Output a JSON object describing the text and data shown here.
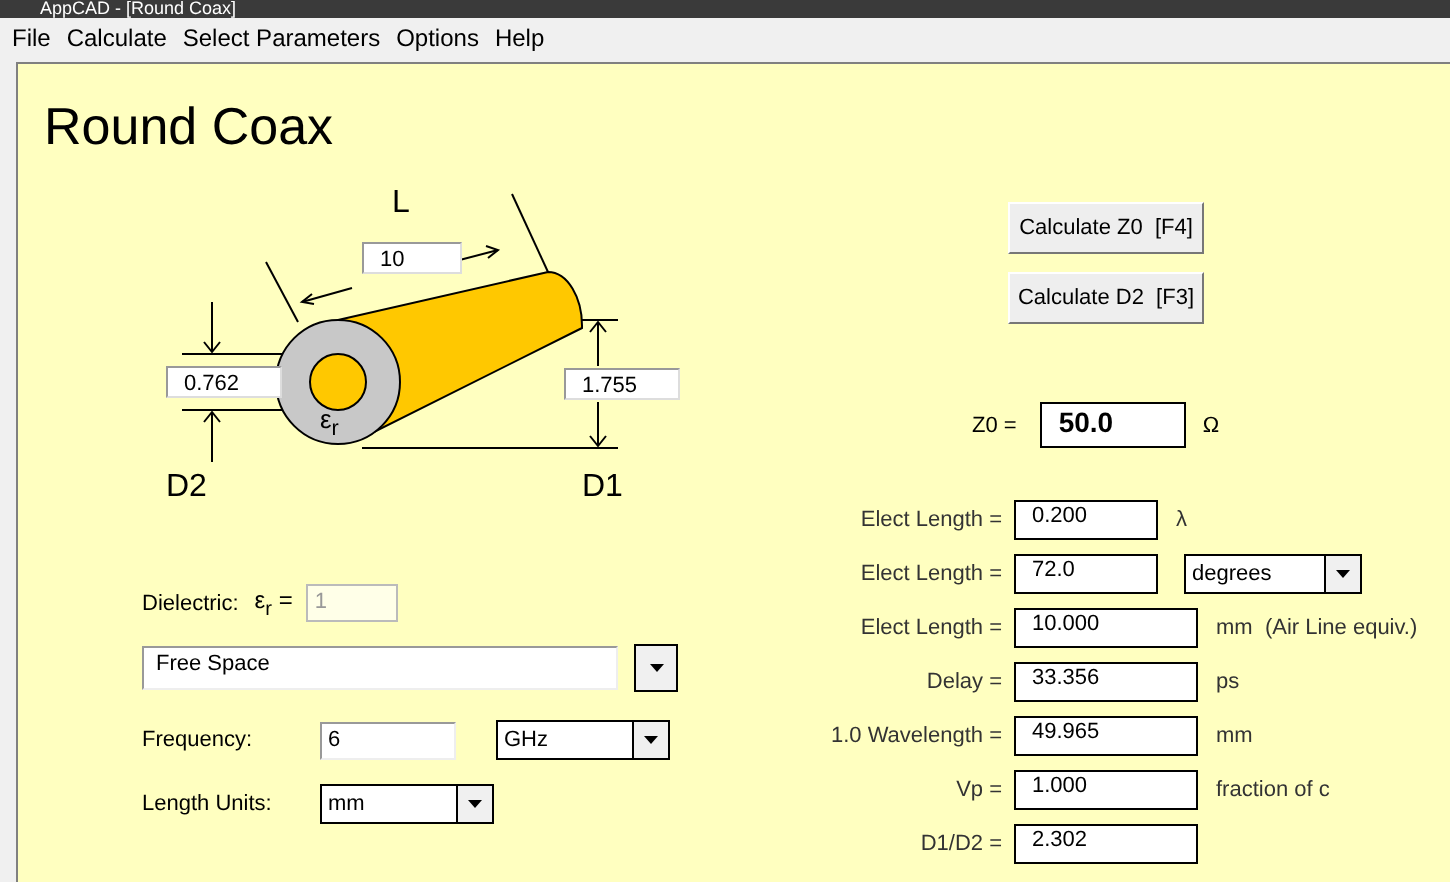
{
  "window": {
    "title": "AppCAD - [Round Coax]"
  },
  "menu": [
    "File",
    "Calculate",
    "Select Parameters",
    "Options",
    "Help"
  ],
  "page_title": "Round Coax",
  "diagram": {
    "length_label": "L",
    "length": "10",
    "inner_diameter": "0.762",
    "outer_diameter": "1.755",
    "inner_label": "D2",
    "outer_label": "D1",
    "dielectric_symbol": "ε$_{r}$"
  },
  "dielectric": {
    "label": "Dielectric:",
    "symbol": "ε$_{r}$ =",
    "value": "1",
    "disabled": true,
    "material": "Free Space"
  },
  "frequency": {
    "label": "Frequency:",
    "value": "6",
    "unit": "GHz"
  },
  "length_units": {
    "label": "Length Units:",
    "value": "mm"
  },
  "buttons": [
    "Calculate Z0  [F4]",
    "Calculate D2  [F3]"
  ],
  "z0": {
    "label": "Z0 =",
    "value": "50.0",
    "unit": "Ω"
  },
  "results": [
    {
      "kind": "short",
      "label": "Elect Length =",
      "value": "0.200",
      "unit": "λ"
    },
    {
      "kind": "select",
      "label": "Elect Length =",
      "value": "72.0",
      "unit": "degrees"
    },
    {
      "kind": "wide",
      "label": "Elect Length =",
      "value": "10.000",
      "unit": "mm  (Air Line equiv.)"
    },
    {
      "kind": "wide",
      "label": "Delay =",
      "value": "33.356",
      "unit": "ps"
    },
    {
      "kind": "wide",
      "label": "1.0 Wavelength =",
      "value": "49.965",
      "unit": "mm"
    },
    {
      "kind": "wide",
      "label": "Vp =",
      "value": "1.000",
      "unit": "fraction of c"
    },
    {
      "kind": "wide",
      "label": "D1/D2 =",
      "value": "2.302"
    }
  ]
}
